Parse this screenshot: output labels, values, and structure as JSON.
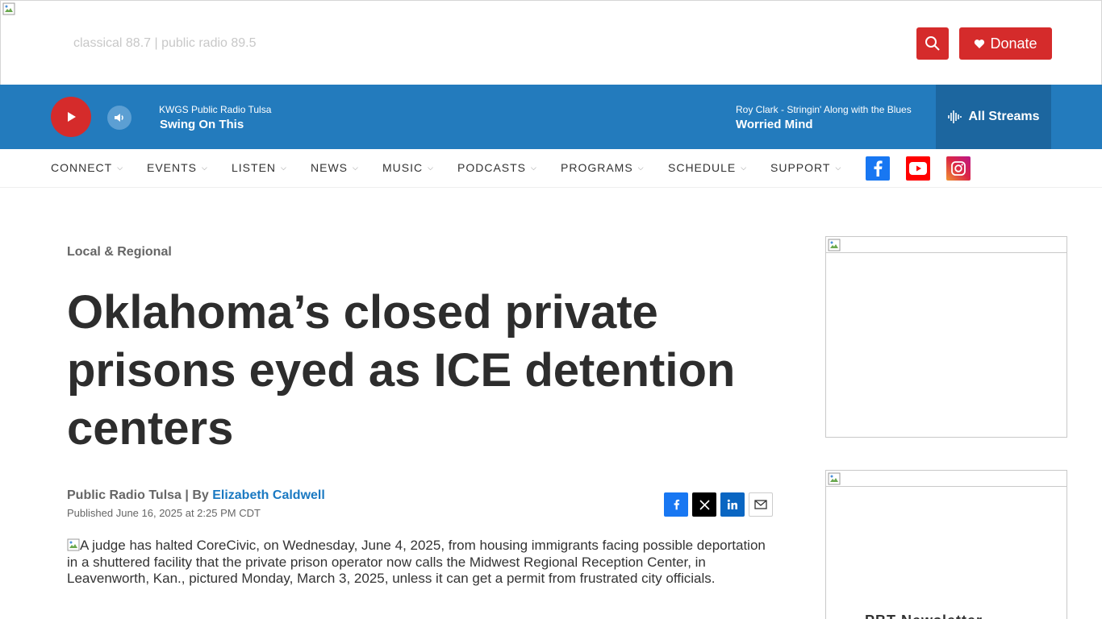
{
  "header": {
    "tagline": "classical 88.7 | public radio 89.5",
    "donate_label": "Donate",
    "accent_color": "#d52b2b"
  },
  "player": {
    "now_station": "KWGS Public Radio Tulsa",
    "now_title": "Swing On This",
    "next_station": "Roy Clark - Stringin' Along with the Blues",
    "next_title": "Worried Mind",
    "streams_label": "All Streams",
    "bar_color": "#237bbd"
  },
  "nav": {
    "items": [
      {
        "label": "CONNECT"
      },
      {
        "label": "EVENTS"
      },
      {
        "label": "LISTEN"
      },
      {
        "label": "NEWS"
      },
      {
        "label": "MUSIC"
      },
      {
        "label": "PODCASTS"
      },
      {
        "label": "PROGRAMS"
      },
      {
        "label": "SCHEDULE"
      },
      {
        "label": "SUPPORT"
      }
    ],
    "social_icons": [
      "facebook-icon",
      "youtube-icon",
      "instagram-icon"
    ]
  },
  "article": {
    "kicker": "Local & Regional",
    "headline": "Oklahoma’s closed private prisons eyed as ICE detention centers",
    "byline_source": "Public Radio Tulsa | By ",
    "byline_author": "Elizabeth Caldwell",
    "published": "Published June 16, 2025 at 2:25 PM CDT",
    "share_icons": [
      "facebook-icon",
      "x-icon",
      "linkedin-icon",
      "email-icon"
    ],
    "image_alt": "A judge has halted CoreCivic, on Wednesday, June 4, 2025, from housing immigrants facing possible deportation in a shuttered facility that the private prison operator now calls the Midwest Regional Reception Center, in Leavenworth, Kan., pictured Monday, March 3, 2025, unless it can get a permit from frustrated city officials."
  },
  "sidebar": {
    "second_ad_partial_text": "PBT Newsletter"
  }
}
